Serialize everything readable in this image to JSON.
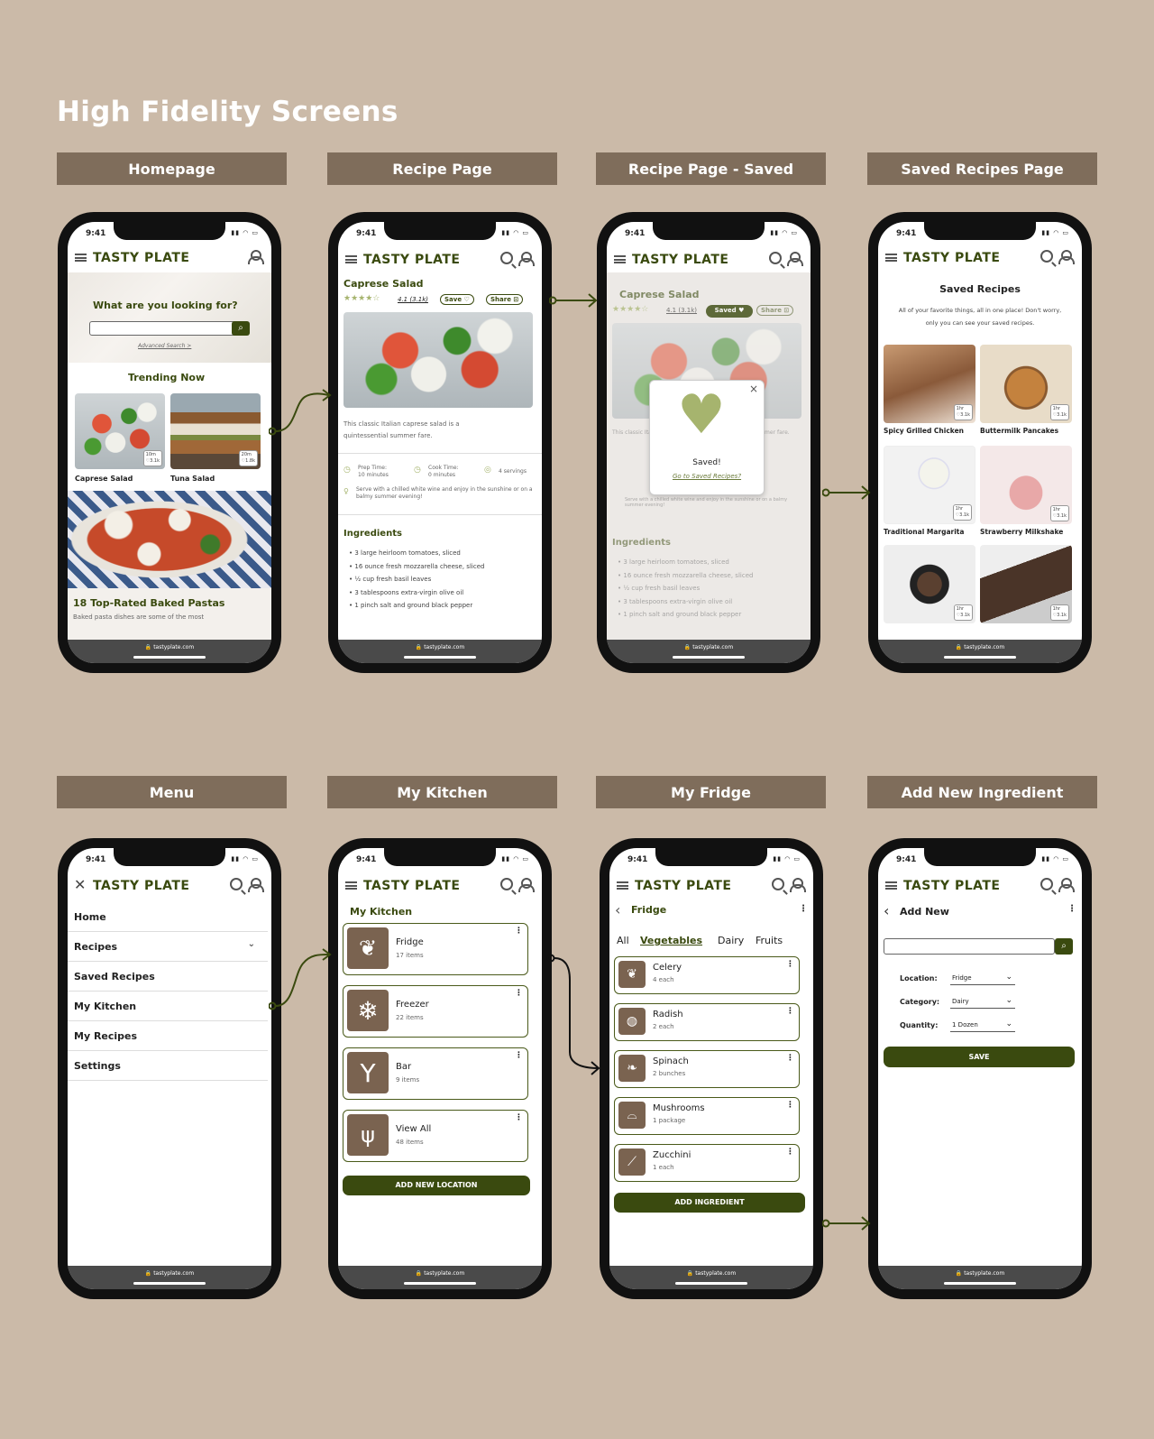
{
  "page_title": "High Fidelity Screens",
  "labels": [
    "Homepage",
    "Recipe Page",
    "Recipe Page - Saved",
    "Saved Recipes Page",
    "Menu",
    "My Kitchen",
    "My Fridge",
    "Add New Ingredient"
  ],
  "status": {
    "time": "9:41",
    "url": "tastyplate.com"
  },
  "brand": "TASTY PLATE",
  "home": {
    "prompt": "What are you looking for?",
    "advanced": "Advanced Search >",
    "trending": "Trending Now",
    "cards": [
      {
        "name": "Caprese Salad",
        "time": "10m",
        "likes": "3.1k"
      },
      {
        "name": "Tuna Salad",
        "time": "20m",
        "likes": "1.8k"
      }
    ],
    "feature_title": "18 Top-Rated Baked Pastas",
    "feature_desc": "Baked pasta dishes are some of the most"
  },
  "recipe": {
    "title": "Caprese Salad",
    "rating": "4.1 (3.1k)",
    "save": "Save",
    "saved": "Saved",
    "share": "Share",
    "desc": "This classic Italian caprese salad is a quintessential summer fare.",
    "prep_label": "Prep Time:",
    "prep_val": "10 minutes",
    "cook_label": "Cook Time:",
    "cook_val": "0 minutes",
    "servings": "4 servings",
    "tip": "Serve with a chilled white wine and enjoy in the sunshine or on a balmy summer evening!",
    "ingredients_title": "Ingredients",
    "ingredients": [
      "3 large heirloom tomatoes, sliced",
      "16 ounce fresh mozzarella cheese, sliced",
      "½ cup fresh basil leaves",
      "3 tablespoons extra-virgin olive oil",
      "1 pinch salt and ground black pepper"
    ],
    "popup_msg": "Saved!",
    "popup_link": "Go to Saved Recipes?"
  },
  "saved_page": {
    "title": "Saved Recipes",
    "desc": "All of your favorite things, all in one place! Don't worry, only you can see your saved recipes.",
    "items": [
      {
        "name": "Spicy Grilled Chicken",
        "time": "1hr",
        "likes": "3.1k"
      },
      {
        "name": "Buttermilk Pancakes",
        "time": "1hr",
        "likes": "3.1k"
      },
      {
        "name": "Traditional Margarita",
        "time": "1hr",
        "likes": "3.1k"
      },
      {
        "name": "Strawberry Milkshake",
        "time": "1hr",
        "likes": "3.1k"
      },
      {
        "name": "",
        "time": "1hr",
        "likes": "3.1k"
      },
      {
        "name": "",
        "time": "1hr",
        "likes": "3.1k"
      }
    ]
  },
  "menu": {
    "items": [
      "Home",
      "Recipes",
      "Saved Recipes",
      "My Kitchen",
      "My Recipes",
      "Settings"
    ]
  },
  "kitchen": {
    "title": "My Kitchen",
    "locations": [
      {
        "name": "Fridge",
        "count": "17 items",
        "icon": "celery-icon"
      },
      {
        "name": "Freezer",
        "count": "22 items",
        "icon": "snowflake-icon"
      },
      {
        "name": "Bar",
        "count": "9 items",
        "icon": "cocktail-icon"
      },
      {
        "name": "View All",
        "count": "48 items",
        "icon": "utensils-icon"
      }
    ],
    "button": "ADD NEW LOCATION"
  },
  "fridge": {
    "title": "Fridge",
    "tabs": [
      "All",
      "Vegetables",
      "Dairy",
      "Fruits"
    ],
    "items": [
      {
        "name": "Celery",
        "qty": "4 each"
      },
      {
        "name": "Radish",
        "qty": "2 each"
      },
      {
        "name": "Spinach",
        "qty": "2 bunches"
      },
      {
        "name": "Mushrooms",
        "qty": "1 package"
      },
      {
        "name": "Zucchini",
        "qty": "1 each"
      }
    ],
    "button": "ADD INGREDIENT"
  },
  "add_new": {
    "title": "Add New",
    "location_label": "Location:",
    "location_val": "Fridge",
    "category_label": "Category:",
    "category_val": "Dairy",
    "quantity_label": "Quantity:",
    "quantity_val": "1 Dozen",
    "button": "SAVE"
  },
  "colors": {
    "background": "#cbbaa8",
    "label": "#7f6d5b",
    "olive": "#3a4a0f",
    "heart": "#a6b46e"
  }
}
